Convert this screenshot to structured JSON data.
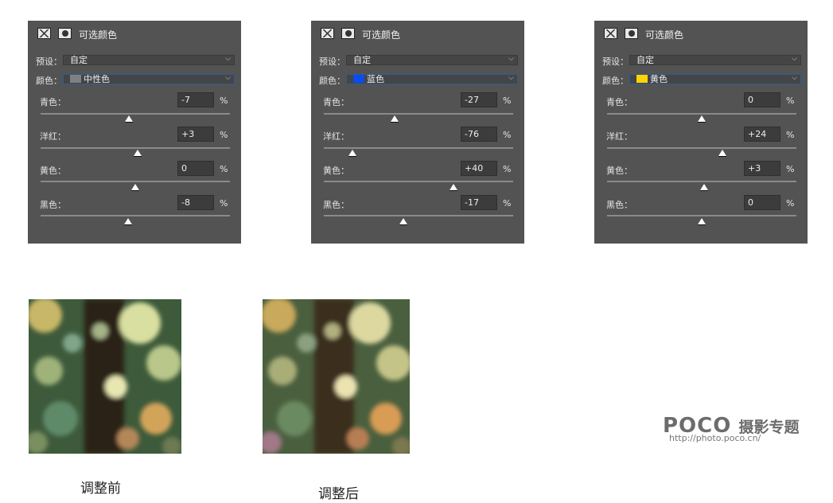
{
  "panels": [
    {
      "title": "可选颜色",
      "preset_label": "预设：",
      "preset_value": "自定",
      "color_label": "颜色：",
      "color_value": "中性色",
      "swatch": "#808080",
      "sliders": [
        {
          "label": "青色：",
          "value": "-7",
          "unit": "%",
          "level": -7
        },
        {
          "label": "洋红：",
          "value": "+3",
          "unit": "%",
          "level": 3
        },
        {
          "label": "黄色：",
          "value": "0",
          "unit": "%",
          "level": 0
        },
        {
          "label": "黑色：",
          "value": "-8",
          "unit": "%",
          "level": -8
        }
      ]
    },
    {
      "title": "可选颜色",
      "preset_label": "预设：",
      "preset_value": "自定",
      "color_label": "颜色：",
      "color_value": "蓝色",
      "swatch": "#0a4cf0",
      "sliders": [
        {
          "label": "青色：",
          "value": "-27",
          "unit": "%",
          "level": -27
        },
        {
          "label": "洋红：",
          "value": "-76",
          "unit": "%",
          "level": -76
        },
        {
          "label": "黄色：",
          "value": "+40",
          "unit": "%",
          "level": 40
        },
        {
          "label": "黑色：",
          "value": "-17",
          "unit": "%",
          "level": -17
        }
      ]
    },
    {
      "title": "可选颜色",
      "preset_label": "预设：",
      "preset_value": "自定",
      "color_label": "颜色：",
      "color_value": "黄色",
      "swatch": "#ffd400",
      "sliders": [
        {
          "label": "青色：",
          "value": "0",
          "unit": "%",
          "level": 0
        },
        {
          "label": "洋红：",
          "value": "+24",
          "unit": "%",
          "level": 24
        },
        {
          "label": "黄色：",
          "value": "+3",
          "unit": "%",
          "level": 3
        },
        {
          "label": "黑色：",
          "value": "0",
          "unit": "%",
          "level": 0
        }
      ]
    }
  ],
  "captions": {
    "before": "调整前",
    "after": "调整后"
  },
  "watermark": {
    "brand": "POCO",
    "subtitle": "摄影专题",
    "url": "http://photo.poco.cn/"
  },
  "colors": {
    "panel_bg": "#535353",
    "select_highlight": "#2c5aa0"
  }
}
